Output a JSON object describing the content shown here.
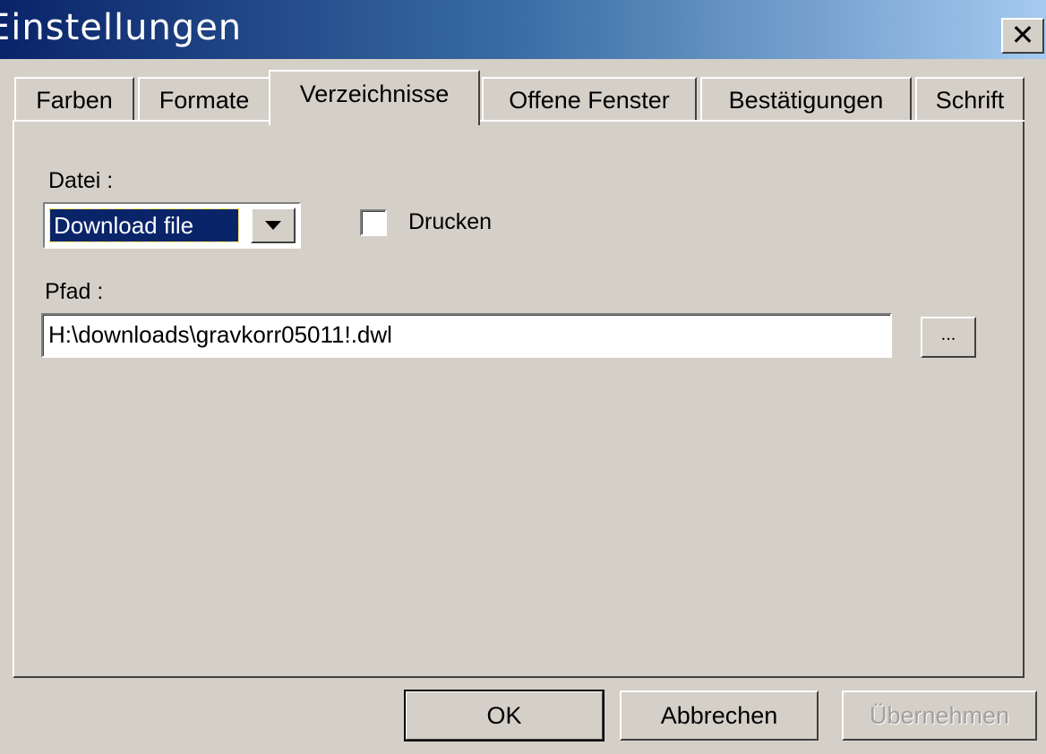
{
  "window": {
    "title": "Einstellungen",
    "close_label": "✕"
  },
  "tabs": [
    {
      "label": "Farben",
      "active": false
    },
    {
      "label": "Formate",
      "active": false
    },
    {
      "label": "Verzeichnisse",
      "active": true
    },
    {
      "label": "Offene Fenster",
      "active": false
    },
    {
      "label": "Bestätigungen",
      "active": false
    },
    {
      "label": "Schrift",
      "active": false
    }
  ],
  "directories": {
    "file_label": "Datei :",
    "file_selected": "Download file",
    "print_label": "Drucken",
    "print_checked": false,
    "path_label": "Pfad :",
    "path_value": "H:\\downloads\\gravkorr05011!.dwl",
    "browse_label": "..."
  },
  "buttons": {
    "ok": "OK",
    "cancel": "Abbrechen",
    "apply": "Übernehmen"
  },
  "colors": {
    "title_gradient_start": "#0a246a",
    "title_gradient_end": "#a6caf0",
    "face": "#d4d0c8",
    "selection": "#0a246a"
  }
}
